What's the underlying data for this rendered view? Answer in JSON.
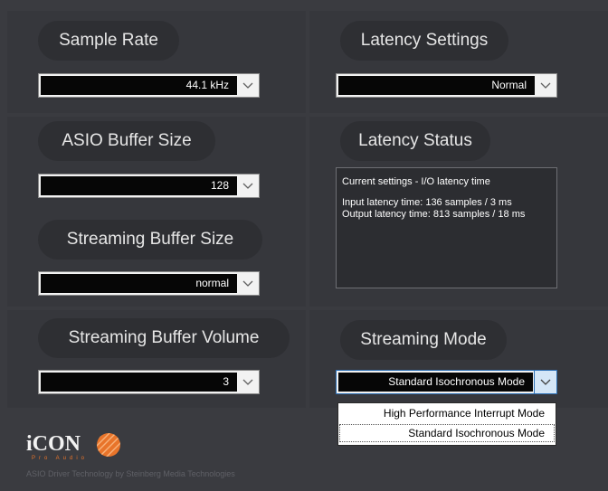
{
  "sample_rate": {
    "title": "Sample Rate",
    "value": "44.1 kHz"
  },
  "latency_settings": {
    "title": "Latency Settings",
    "value": "Normal"
  },
  "asio_buffer": {
    "title": "ASIO Buffer Size",
    "value": "128"
  },
  "latency_status": {
    "title": "Latency Status",
    "line1": "Current settings - I/O latency time",
    "line2": "Input latency time: 136 samples / 3 ms",
    "line3": "Output latency time: 813 samples / 18 ms"
  },
  "streaming_buffer_size": {
    "title": "Streaming Buffer Size",
    "value": "normal"
  },
  "streaming_buffer_volume": {
    "title": "Streaming Buffer Volume",
    "value": "3"
  },
  "streaming_mode": {
    "title": "Streaming Mode",
    "value": "Standard Isochronous Mode",
    "options": [
      "High Performance Interrupt Mode",
      "Standard Isochronous Mode"
    ]
  },
  "footer": {
    "logo_text": "iCON",
    "logo_tagline": "Pro Audio",
    "credit": "ASIO Driver Technology by Steinberg Media Technologies"
  },
  "colors": {
    "accent_orange": "#e8742a",
    "highlight": "#2b6fb5"
  }
}
